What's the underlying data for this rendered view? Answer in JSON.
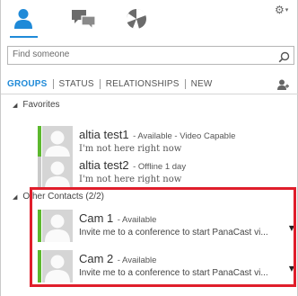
{
  "search": {
    "placeholder": "Find someone"
  },
  "tabs": [
    {
      "label": "GROUPS",
      "active": true
    },
    {
      "label": "STATUS",
      "active": false
    },
    {
      "label": "RELATIONSHIPS",
      "active": false
    },
    {
      "label": "NEW",
      "active": false
    }
  ],
  "groups": [
    {
      "label": "Favorites",
      "contacts": [
        {
          "name": "altia test1",
          "presence": "- Available - Video Capable",
          "note": "I'm not here right now",
          "status_color": "#5cb82e"
        },
        {
          "name": "altia test2",
          "presence": "- Offline 1 day",
          "note": "I'm not here right now",
          "status_color": "#c9c9c9"
        }
      ]
    },
    {
      "label": "Other Contacts (2/2)",
      "contacts": [
        {
          "name": "Cam 1",
          "presence": "- Available",
          "note": "Invite me to a conference to start PanaCast vi...",
          "status_color": "#5cb82e"
        },
        {
          "name": "Cam 2",
          "presence": "- Available",
          "note": "Invite me to a conference to start PanaCast vi...",
          "status_color": "#5cb82e"
        }
      ]
    }
  ],
  "colors": {
    "accent": "#1f8ad8",
    "available": "#5cb82e",
    "offline": "#c9c9c9",
    "highlight": "#e01e2b"
  },
  "icons": {
    "contacts": "contacts-icon",
    "conversations": "conversations-icon",
    "meetings": "meetings-icon",
    "options": "gear-icon",
    "search": "search-icon",
    "add_contact": "add-contact-icon"
  }
}
